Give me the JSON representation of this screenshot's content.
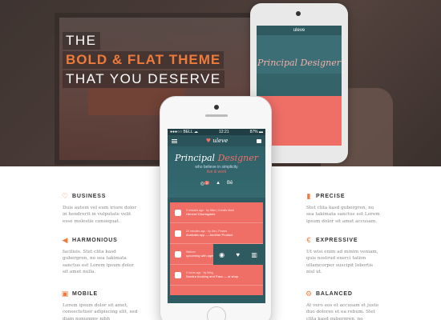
{
  "hero": {
    "title_line1": "THE",
    "title_line2": "BOLD & FLAT THEME",
    "title_line3": "THAT YOU DESERVE",
    "accent_color": "#f07a3a"
  },
  "bg_phone": {
    "brand": "uleve",
    "title": "Principal Designer"
  },
  "phone": {
    "status_carrier": "●●●○○ BELL ☁",
    "status_time": "12:21",
    "status_battery": "87% ▬",
    "brand": "uleve",
    "profile_title_a": "Principal",
    "profile_title_b": "Designer",
    "profile_sub": "who believe in simplicity",
    "profile_sub2": "live & work",
    "badge_count": "2",
    "feed": [
      {
        "meta": "3 minutes ago  ·  by Mike | Credits Maid",
        "text": "Hershel Dhorlagdele",
        "icon": "list-icon"
      },
      {
        "meta": "20 minutes ago  ·  by Jhn | Posted",
        "text": "Australia app — Another Product",
        "icon": "image-icon"
      },
      {
        "meta": "Watson",
        "text": "upcoming with agency",
        "icon": "chat-icon"
      },
      {
        "meta": "3 hours ago  ·  by Ming",
        "text": "Sandra booking and Pass — at shop",
        "icon": "list-icon"
      }
    ]
  },
  "features": {
    "business": {
      "name": "BUSINESS",
      "desc": "Duis autem vel eum iriure dolor in hendrerit in vulputate velit esse molestie consequat."
    },
    "harmonious": {
      "name": "HARMONIOUS",
      "desc": "facilisis. Stet clita kasd gubergren, no sea takimata sanctus est Lorem ipsum dolor sit amet nulla."
    },
    "mobile": {
      "name": "MOBILE",
      "desc": "Lorem ipsum dolor sit amet, consectetuer adipiscing elit, sed diam nonummy nibh"
    },
    "precise": {
      "name": "PRECISE",
      "desc": "Stet clita kasd gubergren, no sea takimata sanctus est Lorem ipsum dolor sit amet accusam."
    },
    "expressive": {
      "name": "EXPRESSIVE",
      "desc": "Ut wisi enim ad minim veniam, quis nostrud exerci tation ullamcorper suscipit lobortis nisl ut."
    },
    "balanced": {
      "name": "BALANCED",
      "desc": "At vero eos et accusam et justo duo dolores et ea rebum. Stet clita kasd gubergren, no"
    }
  }
}
